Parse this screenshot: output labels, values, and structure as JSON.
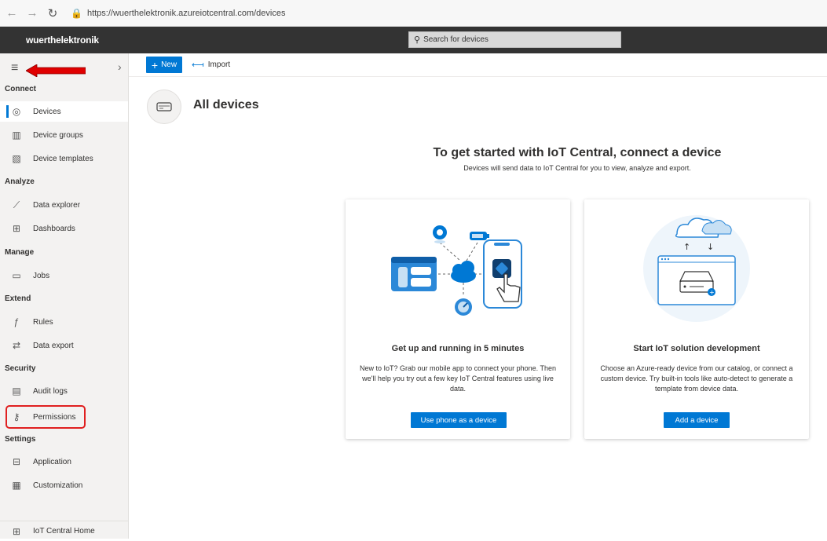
{
  "browser": {
    "url": "https://wuerthelektronik.azureiotcentral.com/devices"
  },
  "header": {
    "brand": "wuerthelektronik",
    "search_placeholder": "Search for devices"
  },
  "sidebar": {
    "sections": [
      {
        "label": "Connect"
      },
      {
        "label": "Analyze"
      },
      {
        "label": "Manage"
      },
      {
        "label": "Extend"
      },
      {
        "label": "Security"
      },
      {
        "label": "Settings"
      }
    ],
    "items": [
      {
        "label": "Devices",
        "icon": "devices-icon"
      },
      {
        "label": "Device groups",
        "icon": "device-groups-icon"
      },
      {
        "label": "Device templates",
        "icon": "device-templates-icon"
      },
      {
        "label": "Data explorer",
        "icon": "chart-icon"
      },
      {
        "label": "Dashboards",
        "icon": "dashboard-icon"
      },
      {
        "label": "Jobs",
        "icon": "jobs-icon"
      },
      {
        "label": "Rules",
        "icon": "rules-icon"
      },
      {
        "label": "Data export",
        "icon": "export-icon"
      },
      {
        "label": "Audit logs",
        "icon": "audit-icon"
      },
      {
        "label": "Permissions",
        "icon": "key-icon"
      },
      {
        "label": "Application",
        "icon": "application-icon"
      },
      {
        "label": "Customization",
        "icon": "customization-icon"
      },
      {
        "label": "IoT Central Home",
        "icon": "home-grid-icon"
      }
    ]
  },
  "toolbar": {
    "new_label": "New",
    "import_label": "Import"
  },
  "main": {
    "title": "All devices",
    "heading": "To get started with IoT Central, connect a device",
    "subheading": "Devices will send data to IoT Central for you to view, analyze and export.",
    "cards": [
      {
        "title": "Get up and running in 5 minutes",
        "description": "New to IoT? Grab our mobile app to connect your phone. Then we'll help you try out a few key IoT Central features using live data.",
        "button": "Use phone as a device"
      },
      {
        "title": "Start IoT solution development",
        "description": "Choose an Azure-ready device from our catalog, or connect a custom device. Try built-in tools like auto-detect to generate a template from device data.",
        "button": "Add a device"
      }
    ]
  },
  "colors": {
    "accent": "#0078d4",
    "header_bg": "#333333",
    "highlight": "#e02020"
  }
}
